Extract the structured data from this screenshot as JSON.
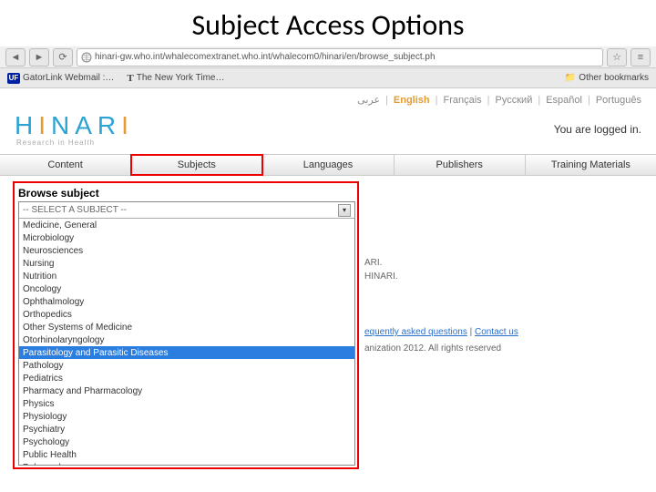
{
  "slide": {
    "title": "Subject Access Options"
  },
  "browser": {
    "url": "hinari-gw.who.int/whalecomextranet.who.int/whalecom0/hinari/en/browse_subject.ph"
  },
  "bookmarks": {
    "item1": "GatorLink Webmail :…",
    "item2": "The New York Time…",
    "other": "Other bookmarks"
  },
  "languages": {
    "ar": "عربى",
    "en": "English",
    "fr": "Français",
    "ru": "Русский",
    "es": "Español",
    "pt": "Português"
  },
  "brand": {
    "subtitle": "Research in Health",
    "loginStatus": "You are logged in."
  },
  "nav": {
    "content": "Content",
    "subjects": "Subjects",
    "languages": "Languages",
    "publishers": "Publishers",
    "training": "Training Materials"
  },
  "browse": {
    "title": "Browse subject",
    "placeholder": "-- SELECT A SUBJECT --"
  },
  "subjects": [
    "Medicine, General",
    "Microbiology",
    "Neurosciences",
    "Nursing",
    "Nutrition",
    "Oncology",
    "Ophthalmology",
    "Orthopedics",
    "Other Systems of Medicine",
    "Otorhinolaryngology",
    "Parasitology and Parasitic Diseases",
    "Pathology",
    "Pediatrics",
    "Pharmacy and Pharmacology",
    "Physics",
    "Physiology",
    "Psychiatry",
    "Psychology",
    "Public Health",
    "Pulmonology"
  ],
  "selectedIndex": 10,
  "background": {
    "snippet1": "ARI.",
    "snippet2": "HINARI.",
    "faqLink": "equently asked questions",
    "contactLink": "Contact us",
    "copyright": "anization 2012. All rights reserved"
  }
}
